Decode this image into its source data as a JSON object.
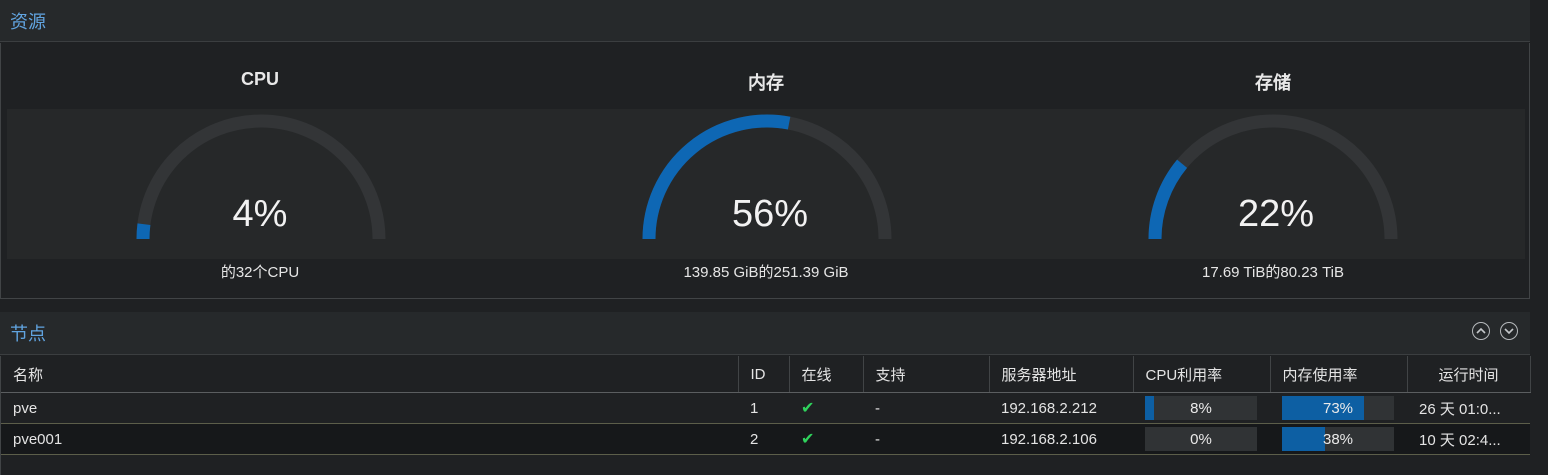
{
  "resources": {
    "title": "资源",
    "gauges": [
      {
        "title": "CPU",
        "value": "4%",
        "percent": 0.04,
        "sub": "的32个CPU"
      },
      {
        "title": "内存",
        "value": "56%",
        "percent": 0.56,
        "sub": "139.85 GiB的251.39 GiB"
      },
      {
        "title": "存储",
        "value": "22%",
        "percent": 0.22,
        "sub": "17.69 TiB的80.23 TiB"
      }
    ],
    "colors": {
      "accent": "#0e67b4",
      "track": "#333537"
    }
  },
  "nodes": {
    "title": "节点",
    "columns": [
      "名称",
      "ID",
      "在线",
      "支持",
      "服务器地址",
      "CPU利用率",
      "内存使用率",
      "运行时间"
    ],
    "rows": [
      {
        "name": "pve",
        "id": "1",
        "online": "✔",
        "support": "-",
        "address": "192.168.2.212",
        "cpu": "8%",
        "cpu_pct": 0.08,
        "mem": "73%",
        "mem_pct": 0.73,
        "uptime": "26 天 01:0..."
      },
      {
        "name": "pve001",
        "id": "2",
        "online": "✔",
        "support": "-",
        "address": "192.168.2.106",
        "cpu": "0%",
        "cpu_pct": 0.0,
        "mem": "38%",
        "mem_pct": 0.38,
        "uptime": "10 天 02:4..."
      }
    ]
  }
}
